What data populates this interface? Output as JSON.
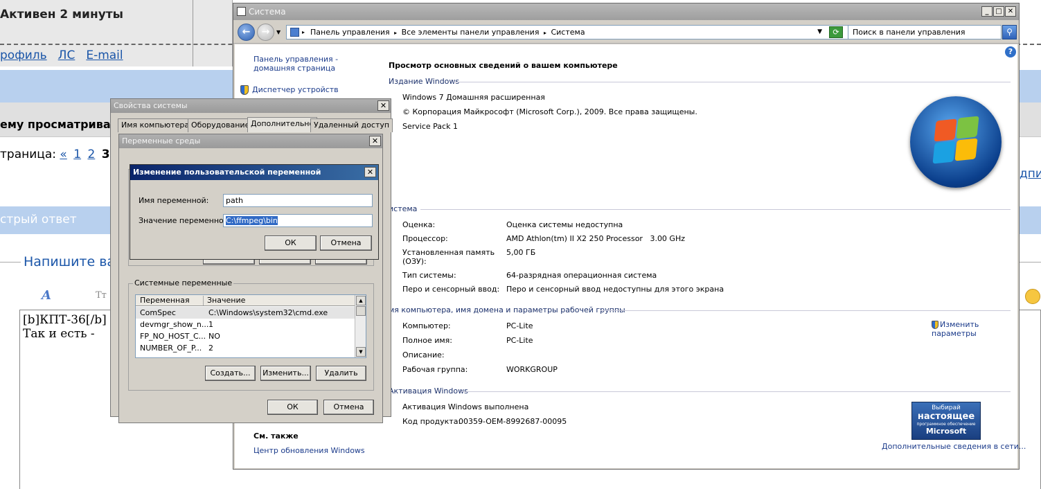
{
  "forum": {
    "status": "Активен 2 минуты",
    "links": [
      "рофиль",
      "ЛС",
      "E-mail"
    ],
    "viewing": "ему просматрива",
    "pages_label": "траница:",
    "pages": [
      "«",
      "1",
      "2"
    ],
    "current_page": "3",
    "quick_reply": "стрый ответ",
    "write_heading": "Напишите ва",
    "format_bold": "A",
    "format_tt": "Tт",
    "textarea_value": "[b]КПТ-36[/b]\nТак и есть -",
    "right_link": "дпи"
  },
  "system_window": {
    "title": "Система",
    "breadcrumb": [
      "Панель управления",
      "Все элементы панели управления",
      "Система"
    ],
    "search_placeholder": "Поиск в панели управления",
    "left_links": [
      "Панель управления - домашняя страница",
      "Диспетчер устройств"
    ],
    "see_also_title": "См. также",
    "see_also_links": [
      "Центр обновления Windows"
    ],
    "main_title": "Просмотр основных сведений о вашем компьютере",
    "edition": {
      "heading": "Издание Windows",
      "name": "Windows 7 Домашняя расширенная",
      "copyright": "© Корпорация Майкрософт (Microsoft Corp.), 2009. Все права защищены.",
      "service_pack": "Service Pack 1"
    },
    "system": {
      "heading": "истема",
      "rows": [
        {
          "label": "Оценка:",
          "value": "Оценка системы недоступна"
        },
        {
          "label": "Процессор:",
          "value": "AMD Athlon(tm) II X2 250 Processor   3.00 GHz"
        },
        {
          "label": "Установленная память (ОЗУ):",
          "value": "5,00 ГБ"
        },
        {
          "label": "Тип системы:",
          "value": "64-разрядная операционная система"
        },
        {
          "label": "Перо и сенсорный ввод:",
          "value": "Перо и сенсорный ввод недоступны для этого экрана"
        }
      ]
    },
    "computer": {
      "heading": "мя компьютера, имя домена и параметры рабочей группы",
      "rows": [
        {
          "label": "Компьютер:",
          "value": "PC-Lite"
        },
        {
          "label": "Полное имя:",
          "value": "PC-Lite"
        },
        {
          "label": "Описание:",
          "value": ""
        },
        {
          "label": "Рабочая группа:",
          "value": "WORKGROUP"
        }
      ],
      "change_link": "Изменить параметры"
    },
    "activation": {
      "heading": "Активация Windows",
      "status": "Активация Windows выполнена",
      "product_key_label": "Код продукта:",
      "product_key": "00359-OEM-8992687-00095",
      "more_link": "Дополнительные сведения в сети...",
      "badge_line1": "Выбирай",
      "badge_line2": "настоящее",
      "badge_line3": "программное обеспечение",
      "badge_line4": "Microsoft"
    }
  },
  "system_properties": {
    "title": "Свойства системы",
    "tabs": [
      "Имя компьютера",
      "Оборудование",
      "Дополнительно",
      "Удаленный доступ"
    ],
    "active_tab": "Дополнительно"
  },
  "env_vars": {
    "title": "Переменные среды",
    "system_group_label": "Системные переменные",
    "columns": [
      "Переменная",
      "Значение"
    ],
    "rows": [
      {
        "name": "ComSpec",
        "value": "C:\\Windows\\system32\\cmd.exe"
      },
      {
        "name": "devmgr_show_n...",
        "value": "1"
      },
      {
        "name": "FP_NO_HOST_C...",
        "value": "NO"
      },
      {
        "name": "NUMBER_OF_P...",
        "value": "2"
      }
    ],
    "create_btn": "Создать...",
    "edit_btn": "Изменить...",
    "delete_btn": "Удалить",
    "ok_btn": "ОК",
    "cancel_btn": "Отмена"
  },
  "edit_var": {
    "title": "Изменение пользовательской переменной",
    "name_label": "Имя переменной:",
    "name_value": "path",
    "value_label": "Значение переменной:",
    "value_value": "C:\\ffmpeg\\bin",
    "ok_btn": "ОК",
    "cancel_btn": "Отмена"
  }
}
